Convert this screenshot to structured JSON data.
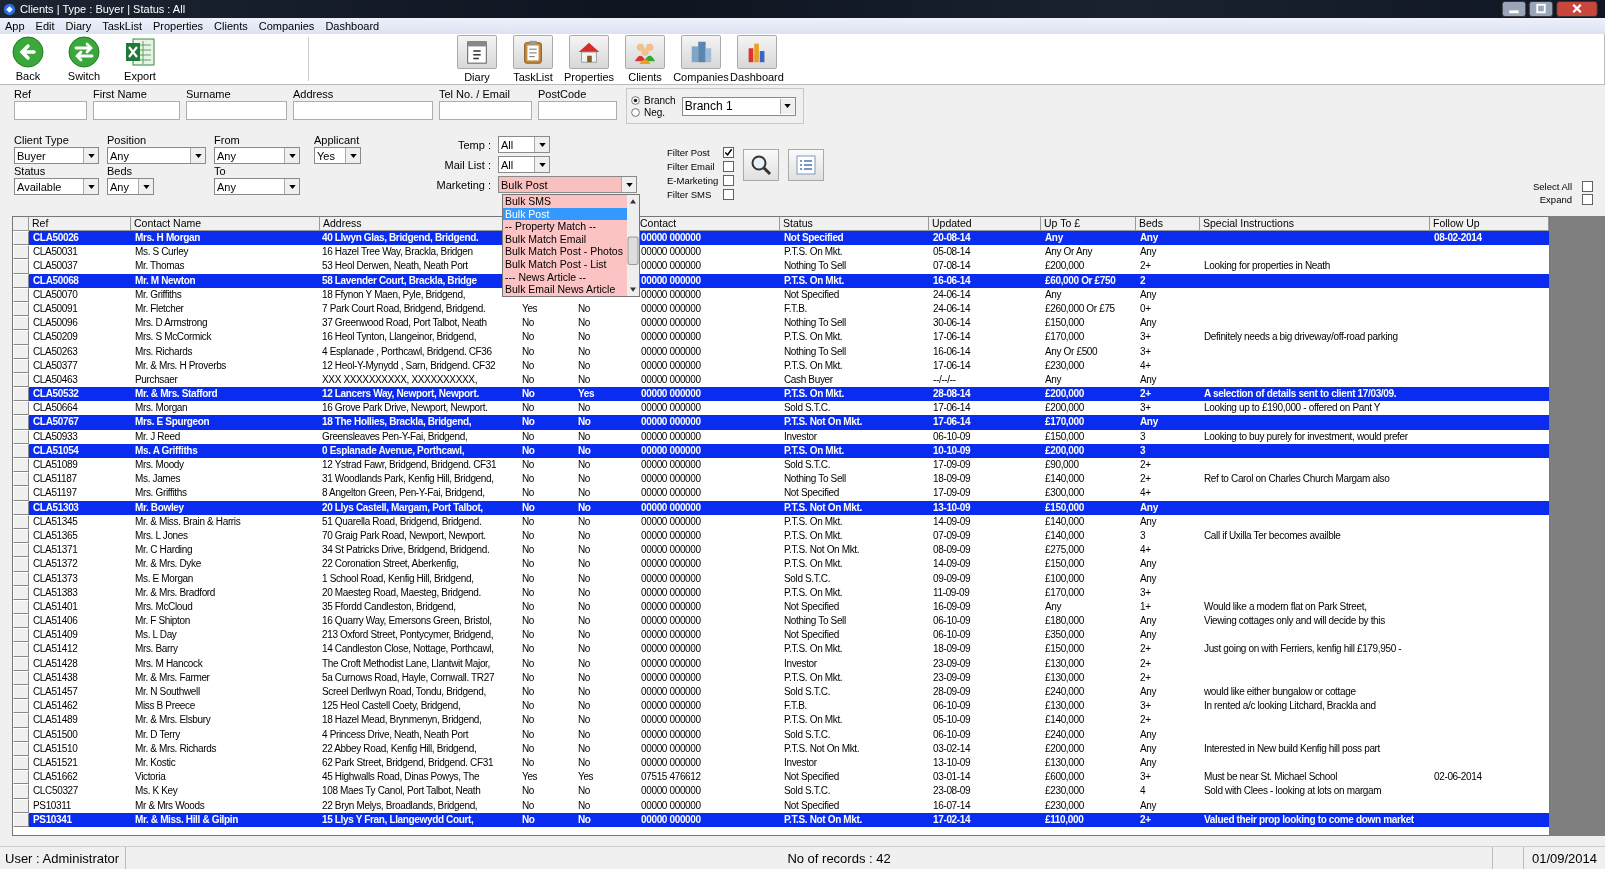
{
  "window": {
    "title": "Clients | Type : Buyer | Status : All"
  },
  "menu": [
    "App",
    "Edit",
    "Diary",
    "TaskList",
    "Properties",
    "Clients",
    "Companies",
    "Dashboard"
  ],
  "toolbar": {
    "left": [
      {
        "label": "Back",
        "kind": "back"
      },
      {
        "label": "Switch",
        "kind": "switch"
      },
      {
        "label": "Export",
        "kind": "export"
      }
    ],
    "right": [
      {
        "label": "Diary",
        "kind": "diary"
      },
      {
        "label": "TaskList",
        "kind": "tasklist"
      },
      {
        "label": "Properties",
        "kind": "properties"
      },
      {
        "label": "Clients",
        "kind": "clients"
      },
      {
        "label": "Companies",
        "kind": "companies"
      },
      {
        "label": "Dashboard",
        "kind": "dashboard"
      }
    ]
  },
  "search_fields": [
    {
      "label": "Ref"
    },
    {
      "label": "First Name"
    },
    {
      "label": "Surname"
    },
    {
      "label": "Address"
    },
    {
      "label": "Tel No. /  Email"
    },
    {
      "label": "PostCode"
    }
  ],
  "branch": {
    "options": [
      {
        "label": "Branch",
        "selected": true
      },
      {
        "label": "Neg.",
        "selected": false
      }
    ],
    "value": "Branch 1"
  },
  "filters": [
    {
      "label": "Client Type",
      "value": "Buyer"
    },
    {
      "label": "Position",
      "value": "Any"
    },
    {
      "label": "From",
      "value": "Any"
    },
    {
      "label": "Applicant",
      "value": "Yes"
    },
    {
      "label": "Status",
      "value": "Available"
    },
    {
      "label": "Beds",
      "value": "Any"
    },
    {
      "label": "To",
      "value": "Any"
    }
  ],
  "options": [
    {
      "label": "Temp :",
      "value": "All"
    },
    {
      "label": "Mail List :",
      "value": "All"
    },
    {
      "label": "Marketing :",
      "value": "Bulk Post"
    }
  ],
  "marketing_list": [
    {
      "label": "Bulk SMS",
      "selected": false
    },
    {
      "label": "Bulk Post",
      "selected": true
    },
    {
      "label": "-- Property Match --",
      "selected": false
    },
    {
      "label": "Bulk Match Email",
      "selected": false
    },
    {
      "label": "Bulk Match Post - Photos",
      "selected": false
    },
    {
      "label": "Bulk Match Post - List",
      "selected": false
    },
    {
      "label": "--- News Article --",
      "selected": false
    },
    {
      "label": "Bulk Email News Article",
      "selected": false
    }
  ],
  "checks": [
    {
      "label": "Filter Post",
      "checked": true
    },
    {
      "label": "Filter Email",
      "checked": false
    },
    {
      "label": "E-Marketing",
      "checked": false
    },
    {
      "label": "Filter SMS",
      "checked": false
    }
  ],
  "right_checks": [
    {
      "label": "Select All",
      "checked": false
    },
    {
      "label": "Expand",
      "checked": false
    }
  ],
  "table": {
    "columns": {
      "ref": "Ref",
      "contact_name": "Contact Name",
      "address": "Address",
      "contact": "Contact",
      "status": "Status",
      "updated": "Updated",
      "up_to": "Up To £",
      "beds": "Beds",
      "special_instructions": "Special Instructions",
      "follow_up": "Follow Up"
    },
    "rows": [
      {
        "selected": true,
        "ref": "CLA50026",
        "contact_name": "Mrs. H Morgan",
        "address": "40 Llwyn Glas, Bridgend, Bridgend.",
        "contact": "00000 000000",
        "status": "Not Specified",
        "updated": "20-08-14",
        "up_to": "Any",
        "beds": "Any",
        "follow_up": "08-02-2014"
      },
      {
        "selected": false,
        "ref": "CLA50031",
        "contact_name": "Ms. S Curley",
        "address": "16 Hazel Tree Way, Brackla, Bridgen",
        "contact": "00000 000000",
        "status": "P.T.S. On Mkt.",
        "updated": "05-08-14",
        "up_to": "Any Or Any",
        "beds": "Any"
      },
      {
        "selected": false,
        "ref": "CLA50037",
        "contact_name": "Mr.  Thomas",
        "address": "53 Heol Derwen, Neath, Neath Port",
        "contact": "00000 000000",
        "status": "Nothing To Sell",
        "updated": "07-08-14",
        "up_to": "£200,000",
        "beds": "2+",
        "special_instructions": "Looking for properties in Neath"
      },
      {
        "selected": true,
        "ref": "CLA50068",
        "contact_name": "Mr. M Newton",
        "address": "58 Lavender Court, Brackla, Bridge",
        "contact": "00000 000000",
        "status": "P.T.S. On Mkt.",
        "updated": "16-06-14",
        "up_to": "£60,000 Or £750",
        "beds": "2"
      },
      {
        "selected": false,
        "ref": "CLA50070",
        "contact_name": "Mr.  Griffiths",
        "address": "18 Ffynon Y Maen, Pyle, Bridgend,",
        "contact": "00000 000000",
        "status": "Not Specified",
        "updated": "24-06-14",
        "up_to": "Any",
        "beds": "Any"
      },
      {
        "selected": false,
        "ref": "CLA50091",
        "contact_name": "Mr.  Fletcher",
        "address": "7 Park Court Road, Bridgend, Bridgend.",
        "column_4": "Yes",
        "column_5": "No",
        "contact": "00000 000000",
        "status": "F.T.B.",
        "updated": "24-06-14",
        "up_to": "£260,000 Or £75",
        "beds": "0+"
      },
      {
        "selected": false,
        "ref": "CLA50096",
        "contact_name": "Mrs. D Armstrong",
        "address": "37 Greenwood Road, Port Talbot, Neath",
        "column_4": "No",
        "column_5": "No",
        "contact": "00000 000000",
        "status": "Nothing To Sell",
        "updated": "30-06-14",
        "up_to": "£150,000",
        "beds": "Any"
      },
      {
        "selected": false,
        "ref": "CLA50209",
        "contact_name": "Mrs. S McCormick",
        "address": "16 Heol Tynton, Llangeinor, Bridgend,",
        "column_4": "No",
        "column_5": "No",
        "contact": "00000 000000",
        "status": "P.T.S. On Mkt.",
        "updated": "17-06-14",
        "up_to": "£170,000",
        "beds": "3+",
        "special_instructions": "Definitely needs a big driveway/off-road parking"
      },
      {
        "selected": false,
        "ref": "CLA50263",
        "contact_name": "Mrs.  Richards",
        "address": "4 Esplanade , Porthcawl, Bridgend. CF36",
        "column_4": "No",
        "column_5": "No",
        "contact": "00000 000000",
        "status": "Nothing To Sell",
        "updated": "16-06-14",
        "up_to": "Any Or £500",
        "beds": "3+"
      },
      {
        "selected": false,
        "ref": "CLA50377",
        "contact_name": "Mr. & Mrs. H Proverbs",
        "address": "12 Heol-Y-Mynydd , Sarn, Bridgend. CF32",
        "column_4": "No",
        "column_5": "No",
        "contact": "00000 000000",
        "status": "P.T.S. On Mkt.",
        "updated": "17-06-14",
        "up_to": "£230,000",
        "beds": "4+"
      },
      {
        "selected": false,
        "ref": "CLA50463",
        "contact_name": "Purchsaer",
        "address": "XXX XXXXXXXXXX, XXXXXXXXXX,",
        "column_4": "No",
        "column_5": "No",
        "contact": "00000 000000",
        "status": "Cash Buyer",
        "updated": "--/--/--",
        "up_to": "Any",
        "beds": "Any"
      },
      {
        "selected": true,
        "ref": "CLA50532",
        "contact_name": "Mr. & Mrs.  Stafford",
        "address": "12 Lancers Way, Newport, Newport.",
        "column_4": "No",
        "column_5": "Yes",
        "contact": "00000 000000",
        "status": "P.T.S. On Mkt.",
        "updated": "28-08-14",
        "up_to": "£200,000",
        "beds": "2+",
        "special_instructions": "A selection of details sent to client 17/03/09."
      },
      {
        "selected": false,
        "ref": "CLA50664",
        "contact_name": "Mrs.  Morgan",
        "address": "16 Grove Park Drive, Newport, Newport.",
        "column_4": "No",
        "column_5": "No",
        "contact": "00000 000000",
        "status": "Sold S.T.C.",
        "updated": "17-06-14",
        "up_to": "£200,000",
        "beds": "3+",
        "special_instructions": "Looking up to £190,000 - offered on Pant Y"
      },
      {
        "selected": true,
        "ref": "CLA50767",
        "contact_name": "Mrs. E Spurgeon",
        "address": "18 The Hollies, Brackla, Bridgend,",
        "column_4": "No",
        "column_5": "No",
        "contact": "00000 000000",
        "status": "P.T.S. Not On Mkt.",
        "updated": "17-06-14",
        "up_to": "£170,000",
        "beds": "Any"
      },
      {
        "selected": false,
        "ref": "CLA50933",
        "contact_name": "Mr. J Reed",
        "address": "Greensleaves Pen-Y-Fai, Bridgend,",
        "column_4": "No",
        "column_5": "No",
        "contact": "00000 000000",
        "status": "Investor",
        "updated": "06-10-09",
        "up_to": "£150,000",
        "beds": "3",
        "special_instructions": "Looking to buy purely for investment, would prefer"
      },
      {
        "selected": true,
        "ref": "CLA51054",
        "contact_name": "Ms. A Griffiths",
        "address": "0 Esplanade Avenue, Porthcawl,",
        "column_4": "No",
        "column_5": "No",
        "contact": "00000 000000",
        "status": "P.T.S. On Mkt.",
        "updated": "10-10-09",
        "up_to": "£200,000",
        "beds": "3"
      },
      {
        "selected": false,
        "ref": "CLA51089",
        "contact_name": "Mrs.  Moody",
        "address": "12 Ystrad Fawr, Bridgend, Bridgend. CF31",
        "column_4": "No",
        "column_5": "No",
        "contact": "00000 000000",
        "status": "Sold S.T.C.",
        "updated": "17-09-09",
        "up_to": "£90,000",
        "beds": "2+"
      },
      {
        "selected": false,
        "ref": "CLA51187",
        "contact_name": "Ms.  James",
        "address": "31 Woodlands Park, Kenfig Hill, Bridgend,",
        "column_4": "No",
        "column_5": "No",
        "contact": "00000 000000",
        "status": "Nothing To Sell",
        "updated": "18-09-09",
        "up_to": "£140,000",
        "beds": "2+",
        "special_instructions": "Ref to Carol on Charles Church Margam also"
      },
      {
        "selected": false,
        "ref": "CLA51197",
        "contact_name": "Mrs.  Griffiths",
        "address": "8 Angelton Green, Pen-Y-Fai, Bridgend,",
        "column_4": "No",
        "column_5": "No",
        "contact": "00000 000000",
        "status": "Not Specified",
        "updated": "17-09-09",
        "up_to": "£300,000",
        "beds": "4+"
      },
      {
        "selected": true,
        "ref": "CLA51303",
        "contact_name": "Mr.  Bowley",
        "address": "20  Llys Castell, Margam, Port Talbot,",
        "column_4": "No",
        "column_5": "No",
        "contact": "00000 000000",
        "status": "P.T.S. Not On Mkt.",
        "updated": "13-10-09",
        "up_to": "£150,000",
        "beds": "Any"
      },
      {
        "selected": false,
        "ref": "CLA51345",
        "contact_name": "Mr. & Miss.  Brain & Harris",
        "address": "51 Quarella Road, Bridgend, Bridgend.",
        "column_4": "No",
        "column_5": "No",
        "contact": "00000 000000",
        "status": "P.T.S. On Mkt.",
        "updated": "14-09-09",
        "up_to": "£140,000",
        "beds": "Any"
      },
      {
        "selected": false,
        "ref": "CLA51365",
        "contact_name": "Mrs. L Jones",
        "address": "70 Graig Park Road, Newport, Newport.",
        "column_4": "No",
        "column_5": "No",
        "contact": "00000 000000",
        "status": "P.T.S. On Mkt.",
        "updated": "07-09-09",
        "up_to": "£140,000",
        "beds": "3",
        "special_instructions": "Call if Uxilla Ter becomes availble"
      },
      {
        "selected": false,
        "ref": "CLA51371",
        "contact_name": "Mr. C Harding",
        "address": "34 St Patricks Drive, Bridgend, Bridgend.",
        "column_4": "No",
        "column_5": "No",
        "contact": "00000 000000",
        "status": "P.T.S. Not On Mkt.",
        "updated": "08-09-09",
        "up_to": "£275,000",
        "beds": "4+"
      },
      {
        "selected": false,
        "ref": "CLA51372",
        "contact_name": "Mr. & Mrs.  Dyke",
        "address": "22 Coronation Street, Aberkenfig,",
        "column_4": "No",
        "column_5": "No",
        "contact": "00000 000000",
        "status": "P.T.S. On Mkt.",
        "updated": "14-09-09",
        "up_to": "£150,000",
        "beds": "Any"
      },
      {
        "selected": false,
        "ref": "CLA51373",
        "contact_name": "Ms. E Morgan",
        "address": "1 School Road, Kenfig Hill, Bridgend,",
        "column_4": "No",
        "column_5": "No",
        "contact": "00000 000000",
        "status": "Sold S.T.C.",
        "updated": "09-09-09",
        "up_to": "£100,000",
        "beds": "Any"
      },
      {
        "selected": false,
        "ref": "CLA51383",
        "contact_name": "Mr. & Mrs.  Bradford",
        "address": "20 Maesteg Road, Maesteg, Bridgend.",
        "column_4": "No",
        "column_5": "No",
        "contact": "00000 000000",
        "status": "P.T.S. On Mkt.",
        "updated": "11-09-09",
        "up_to": "£170,000",
        "beds": "3+"
      },
      {
        "selected": false,
        "ref": "CLA51401",
        "contact_name": "Mrs.  McCloud",
        "address": "35 Ffordd Candleston, Bridgend,",
        "column_4": "No",
        "column_5": "No",
        "contact": "00000 000000",
        "status": "Not Specified",
        "updated": "16-09-09",
        "up_to": "Any",
        "beds": "1+",
        "special_instructions": "Would like a modern flat on Park Street,"
      },
      {
        "selected": false,
        "ref": "CLA51406",
        "contact_name": "Mr. F Shipton",
        "address": "16 Quarry Way, Emersons Green, Bristol,",
        "column_4": "No",
        "column_5": "No",
        "contact": "00000 000000",
        "status": "Nothing To Sell",
        "updated": "06-10-09",
        "up_to": "£180,000",
        "beds": "Any",
        "special_instructions": "Viewing cottages only and will decide by this"
      },
      {
        "selected": false,
        "ref": "CLA51409",
        "contact_name": "Ms. L Day",
        "address": "213 Oxford Street, Pontycymer, Bridgend,",
        "column_4": "No",
        "column_5": "No",
        "contact": "00000 000000",
        "status": "Not Specified",
        "updated": "06-10-09",
        "up_to": "£350,000",
        "beds": "Any"
      },
      {
        "selected": false,
        "ref": "CLA51412",
        "contact_name": "Mrs.  Barry",
        "address": "14 Candleston Close, Nottage, Porthcawl,",
        "column_4": "No",
        "column_5": "No",
        "contact": "00000 000000",
        "status": "P.T.S. On Mkt.",
        "updated": "18-09-09",
        "up_to": "£150,000",
        "beds": "2+",
        "special_instructions": "Just going on with Ferriers, kenfig hill £179,950 -"
      },
      {
        "selected": false,
        "ref": "CLA51428",
        "contact_name": "Mrs. M Hancock",
        "address": "The Croft Methodist Lane, Llantwit Major,",
        "column_4": "No",
        "column_5": "No",
        "contact": "00000 000000",
        "status": "Investor",
        "updated": "23-09-09",
        "up_to": "£130,000",
        "beds": "2+"
      },
      {
        "selected": false,
        "ref": "CLA51438",
        "contact_name": "Mr. & Mrs.  Farmer",
        "address": "5a Curnows Road, Hayle, Cornwall. TR27",
        "column_4": "No",
        "column_5": "No",
        "contact": "00000 000000",
        "status": "P.T.S. On Mkt.",
        "updated": "23-09-09",
        "up_to": "£130,000",
        "beds": "2+"
      },
      {
        "selected": false,
        "ref": "CLA51457",
        "contact_name": "Mr. N Southwell",
        "address": "Screel Derllwyn Road, Tondu, Bridgend,",
        "column_4": "No",
        "column_5": "No",
        "contact": "00000 000000",
        "status": "Sold S.T.C.",
        "updated": "28-09-09",
        "up_to": "£240,000",
        "beds": "Any",
        "special_instructions": "would like either bungalow or cottage"
      },
      {
        "selected": false,
        "ref": "CLA51462",
        "contact_name": "Miss B Preece",
        "address": "125 Heol Castell Coety, Bridgend,",
        "column_4": "No",
        "column_5": "No",
        "contact": "00000 000000",
        "status": "F.T.B.",
        "updated": "06-10-09",
        "up_to": "£130,000",
        "beds": "3+",
        "special_instructions": "In rented a/c looking Litchard, Brackla and"
      },
      {
        "selected": false,
        "ref": "CLA51489",
        "contact_name": "Mr. & Mrs.  Elsbury",
        "address": "18 Hazel Mead, Brynmenyn, Bridgend,",
        "column_4": "No",
        "column_5": "No",
        "contact": "00000 000000",
        "status": "P.T.S. On Mkt.",
        "updated": "05-10-09",
        "up_to": "£140,000",
        "beds": "2+"
      },
      {
        "selected": false,
        "ref": "CLA51500",
        "contact_name": "Mr. D Terry",
        "address": "4 Princess Drive, Neath, Neath Port",
        "column_4": "No",
        "column_5": "No",
        "contact": "00000 000000",
        "status": "Sold S.T.C.",
        "updated": "06-10-09",
        "up_to": "£240,000",
        "beds": "Any"
      },
      {
        "selected": false,
        "ref": "CLA51510",
        "contact_name": "Mr. & Mrs.  Richards",
        "address": "22 Abbey Road, Kenfig Hill, Bridgend,",
        "column_4": "No",
        "column_5": "No",
        "contact": "00000 000000",
        "status": "P.T.S. Not On Mkt.",
        "updated": "03-02-14",
        "up_to": "£200,000",
        "beds": "Any",
        "special_instructions": "Interested in New build Kenfig hill poss part"
      },
      {
        "selected": false,
        "ref": "CLA51521",
        "contact_name": "Mr.  Kostic",
        "address": "62 Park Street, Bridgend, Bridgend. CF31",
        "column_4": "No",
        "column_5": "No",
        "contact": "00000 000000",
        "status": "Investor",
        "updated": "13-10-09",
        "up_to": "£130,000",
        "beds": "Any"
      },
      {
        "selected": false,
        "ref": "CLA51662",
        "contact_name": "Victoria",
        "address": "45 Highwalls Road, Dinas Powys, The",
        "column_4": "Yes",
        "column_5": "Yes",
        "contact": "07515 476612",
        "status": "Not Specified",
        "updated": "03-01-14",
        "up_to": "£600,000",
        "beds": "3+",
        "special_instructions": "Must be near St. Michael School",
        "follow_up": "02-06-2014"
      },
      {
        "selected": false,
        "ref": "CLC50327",
        "contact_name": "Ms. K Key",
        "address": "108 Maes Ty Canol, Port Talbot, Neath",
        "column_4": "No",
        "column_5": "No",
        "contact": "00000 000000",
        "status": "Sold S.T.C.",
        "updated": "23-08-09",
        "up_to": "£230,000",
        "beds": "4",
        "special_instructions": "Sold with Clees - looking at lots on margam"
      },
      {
        "selected": false,
        "ref": "PS10311",
        "contact_name": "Mr & Mrs Woods",
        "address": "22 Bryn Melys, Broadlands, Bridgend,",
        "column_4": "No",
        "column_5": "No",
        "contact": "00000 000000",
        "status": "Not Specified",
        "updated": "16-07-14",
        "up_to": "£230,000",
        "beds": "Any"
      },
      {
        "selected": true,
        "ref": "PS10341",
        "contact_name": "Mr. & Miss.  Hill & Gilpin",
        "address": "15 Llys Y Fran, Llangewydd Court,",
        "column_4": "No",
        "column_5": "No",
        "contact": "00000 000000",
        "status": "P.T.S. Not On Mkt.",
        "updated": "17-02-14",
        "up_to": "£110,000",
        "beds": "2+",
        "special_instructions": "Valued their prop looking to come down market"
      }
    ]
  },
  "status_bar": {
    "user": "User : Administrator",
    "records": "No of records : 42",
    "date": "01/09/2014"
  }
}
